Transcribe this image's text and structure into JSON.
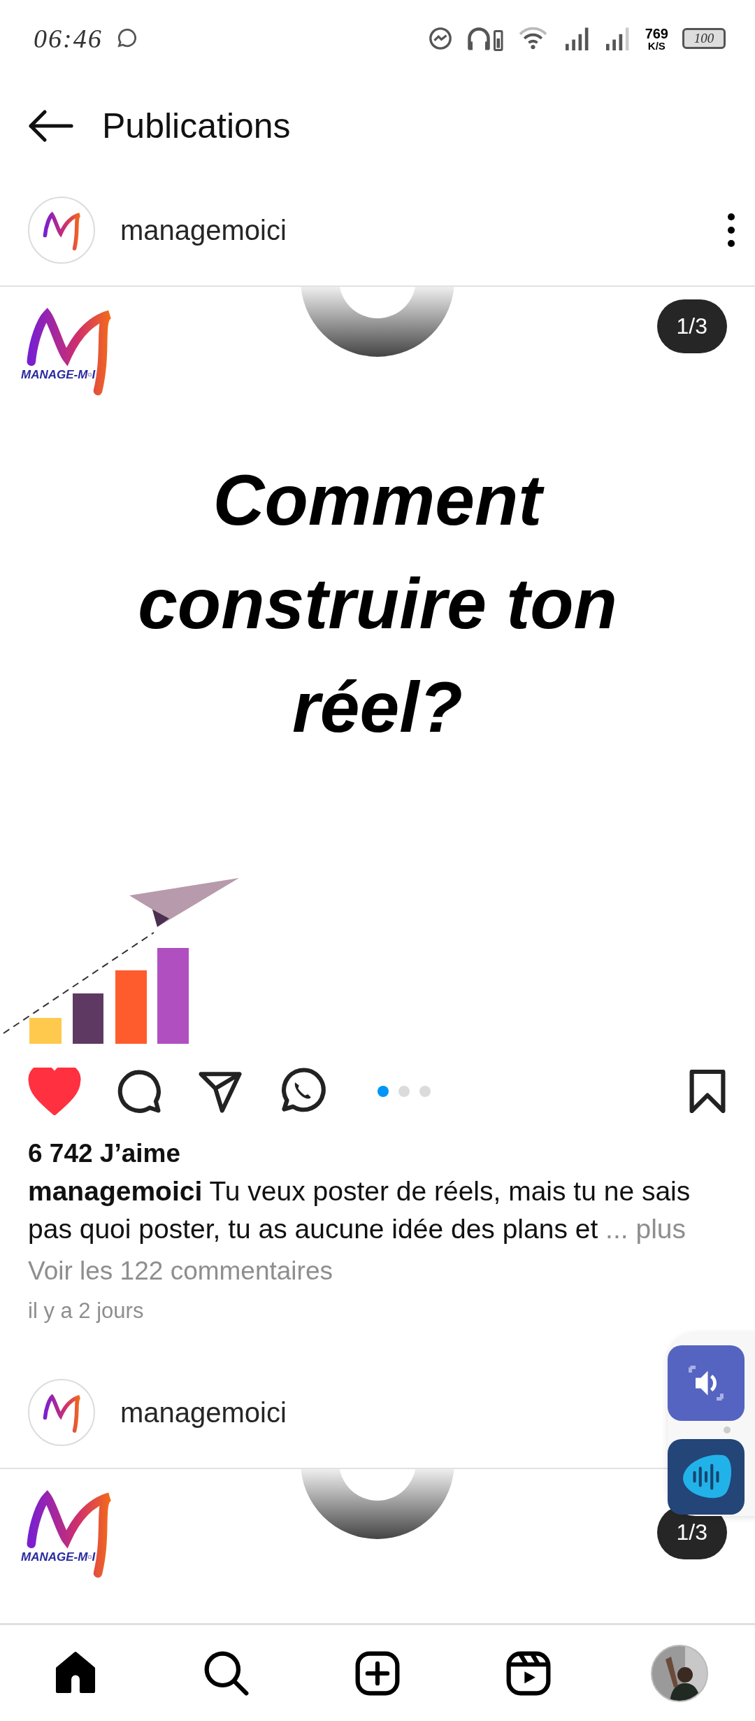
{
  "status_bar": {
    "time": "06:46",
    "net_speed": "769",
    "net_unit": "K/S",
    "battery": "100"
  },
  "header": {
    "title": "Publications"
  },
  "posts": [
    {
      "username": "managemoici",
      "slide_counter": "1/3",
      "logo_text": "MANAGE-M▫I",
      "headline": [
        "Comment",
        "construire ton",
        "réel?"
      ],
      "liked": true,
      "saved": false,
      "carousel_dots": [
        {
          "selected": true
        },
        {
          "selected": false
        },
        {
          "selected": false
        }
      ],
      "likes": "6 742 J’aime",
      "caption_user": "managemoici",
      "caption": "Tu veux poster de réels, mais tu ne sais pas quoi poster, tu as aucune idée des plans et",
      "more": "... plus",
      "comments": "Voir les 122 commentaires",
      "time_ago": "il y a 2 jours"
    },
    {
      "username": "managemoici",
      "slide_counter": "1/3",
      "logo_text": "MANAGE-M▫I"
    }
  ],
  "bottom_nav": [
    {
      "kind": "home",
      "selected": true
    },
    {
      "kind": "search",
      "selected": false
    },
    {
      "kind": "create",
      "selected": false
    },
    {
      "kind": "reels",
      "selected": false
    },
    {
      "kind": "profile",
      "selected": false
    }
  ]
}
